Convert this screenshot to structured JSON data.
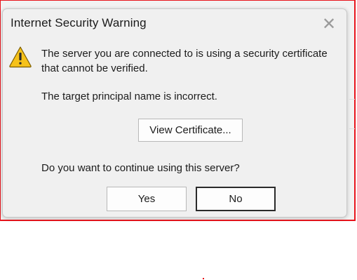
{
  "dialog": {
    "title": "Internet Security Warning",
    "close_glyph": "✕",
    "icon": "warning-triangle-icon",
    "message_line1": "The server you are connected to is using a security certificate",
    "message_line2": "that cannot be verified.",
    "detail": "The target principal name is incorrect.",
    "view_certificate_label": "View Certificate...",
    "question": "Do you want to continue using this server?",
    "yes_label": "Yes",
    "no_label": "No"
  },
  "colors": {
    "frame_border": "#e8141c",
    "dialog_bg": "#f0f0f0",
    "warning_yellow": "#f6c21a"
  }
}
